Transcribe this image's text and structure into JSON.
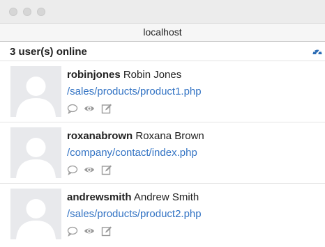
{
  "window": {
    "address": "localhost"
  },
  "panel": {
    "online_count": "3 user(s) online",
    "dashboard_icon": "dashboard-gauge-icon"
  },
  "users": [
    {
      "username": "robinjones",
      "full_name": "Robin Jones",
      "url": "/sales/products/product1.php",
      "actions": [
        "chat-bubble-icon",
        "eye-icon",
        "edit-icon"
      ]
    },
    {
      "username": "roxanabrown",
      "full_name": "Roxana Brown",
      "url": "/company/contact/index.php",
      "actions": [
        "chat-bubble-icon",
        "eye-icon",
        "edit-icon"
      ]
    },
    {
      "username": "andrewsmith",
      "full_name": "Andrew Smith",
      "url": "/sales/products/product2.php",
      "actions": [
        "chat-bubble-icon",
        "eye-icon",
        "edit-icon"
      ]
    }
  ],
  "colors": {
    "link": "#3474c4",
    "accent_icon": "#2d6db5",
    "action_icon": "#9a9a9a"
  }
}
